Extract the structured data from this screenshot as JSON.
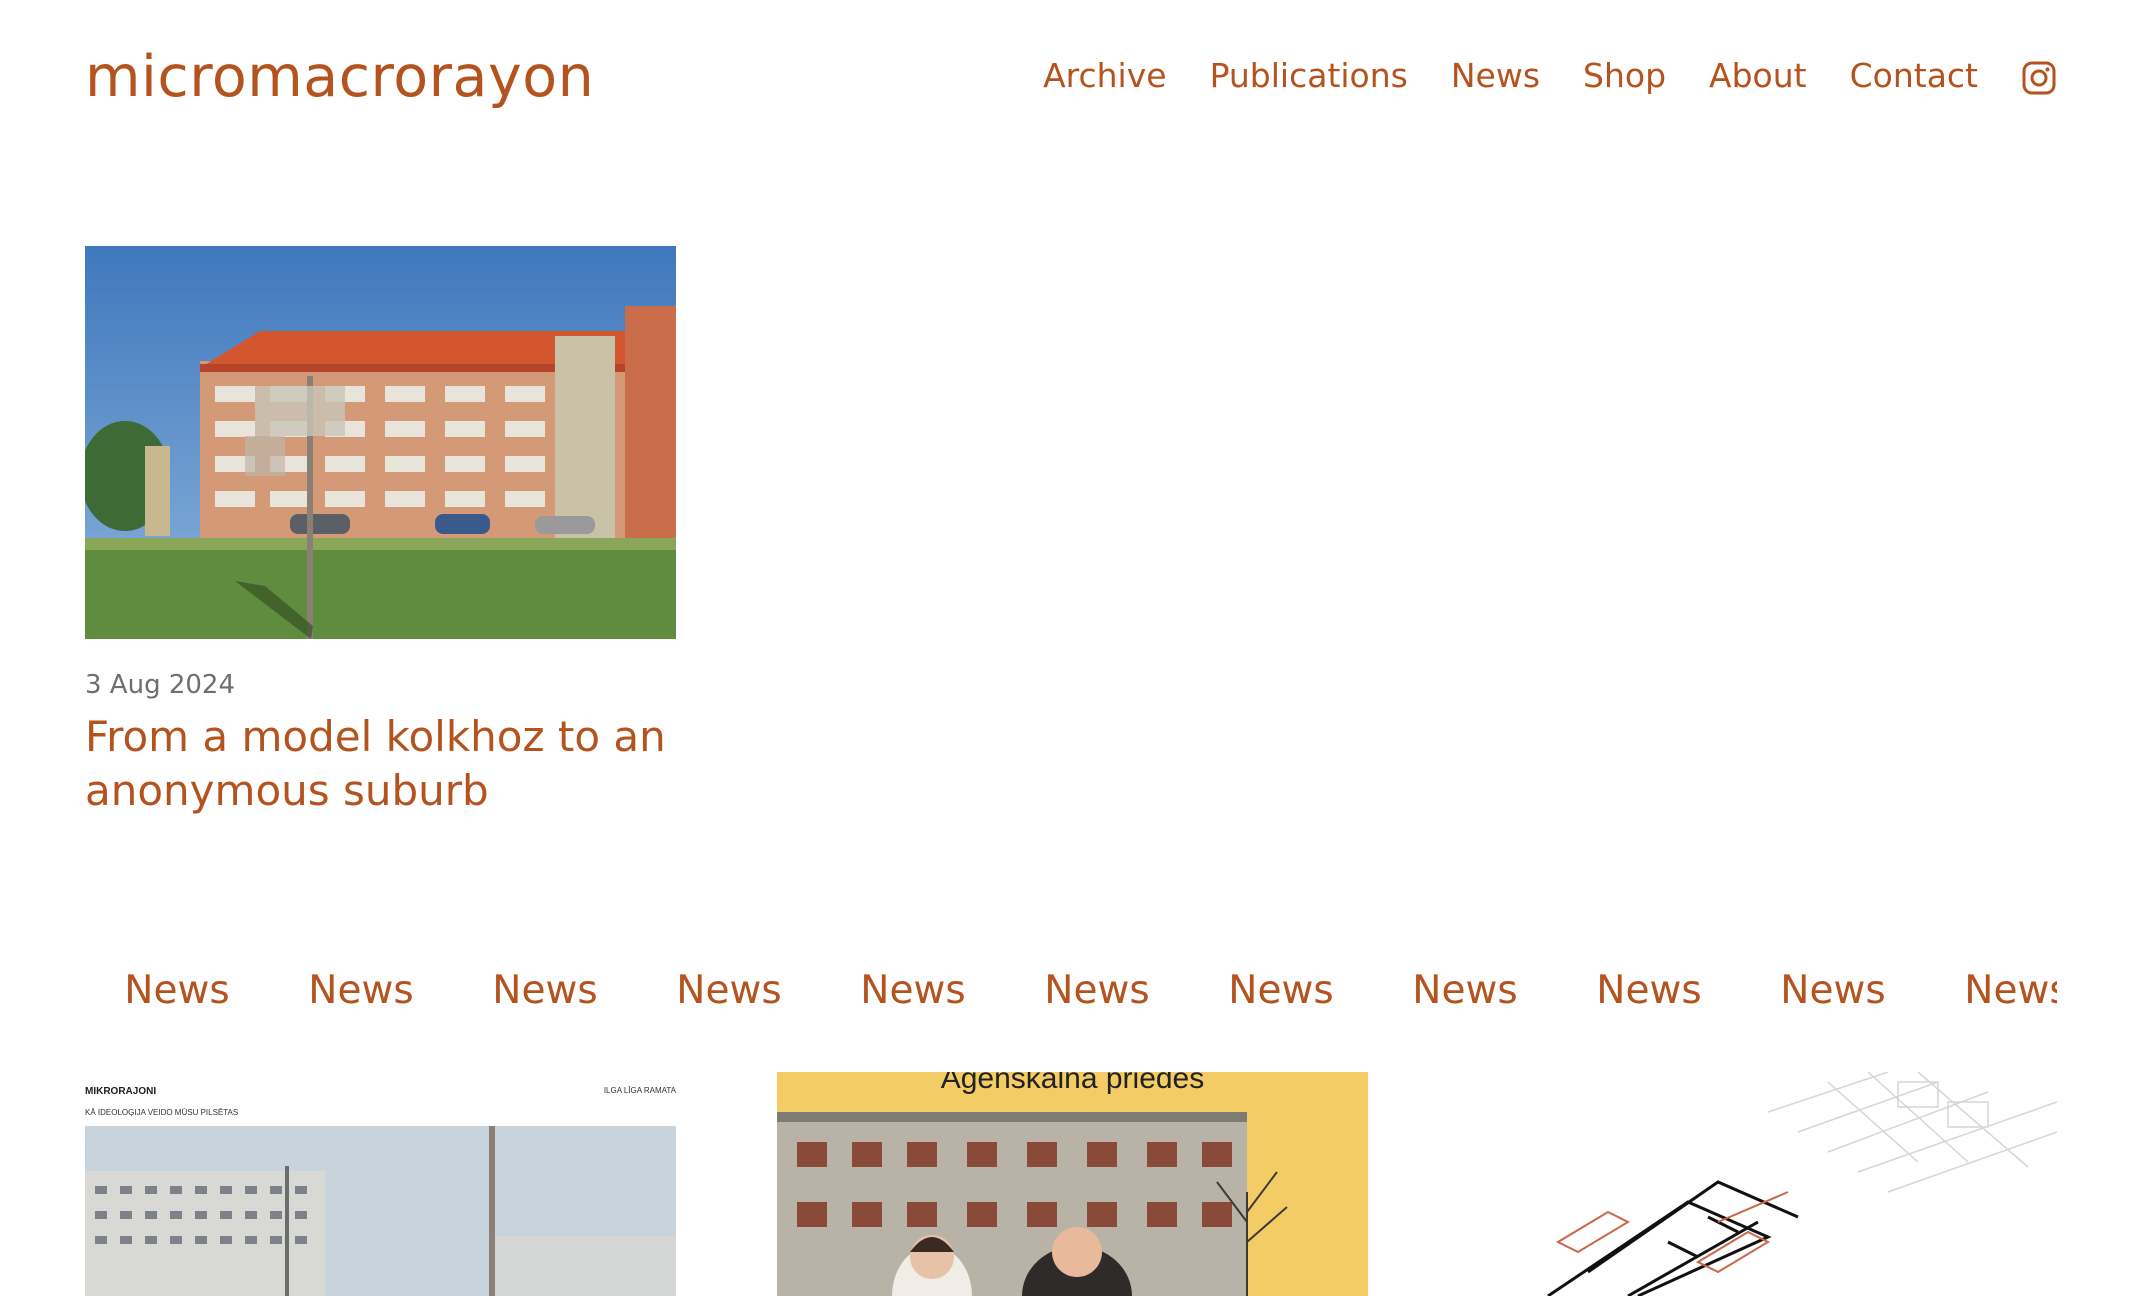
{
  "site": {
    "logo": "micromacrorayon"
  },
  "nav": {
    "items": [
      "Archive",
      "Publications",
      "News",
      "Shop",
      "About",
      "Contact"
    ],
    "instagram_icon": "instagram-icon"
  },
  "featured": {
    "date": "3 Aug 2024",
    "title": "From a model kolkhoz to an anonymous suburb"
  },
  "marquee": {
    "items": [
      "News",
      "News",
      "News",
      "News",
      "News",
      "News",
      "News",
      "News",
      "News",
      "News",
      "News"
    ]
  },
  "cards": {
    "card1": {
      "poster_title": "MIKRORAJONI",
      "poster_subtitle": "KĀ IDEOLOĢIJA VEIDO MŪSU PILSĒTAS",
      "poster_author": "ILGA LĪGA RAMATA"
    },
    "card2": {
      "poster_title": "Āgenskalna priedes"
    }
  },
  "colors": {
    "accent": "#b5531f",
    "muted": "#6f6f6f",
    "poster_yellow": "#f4cc66"
  }
}
